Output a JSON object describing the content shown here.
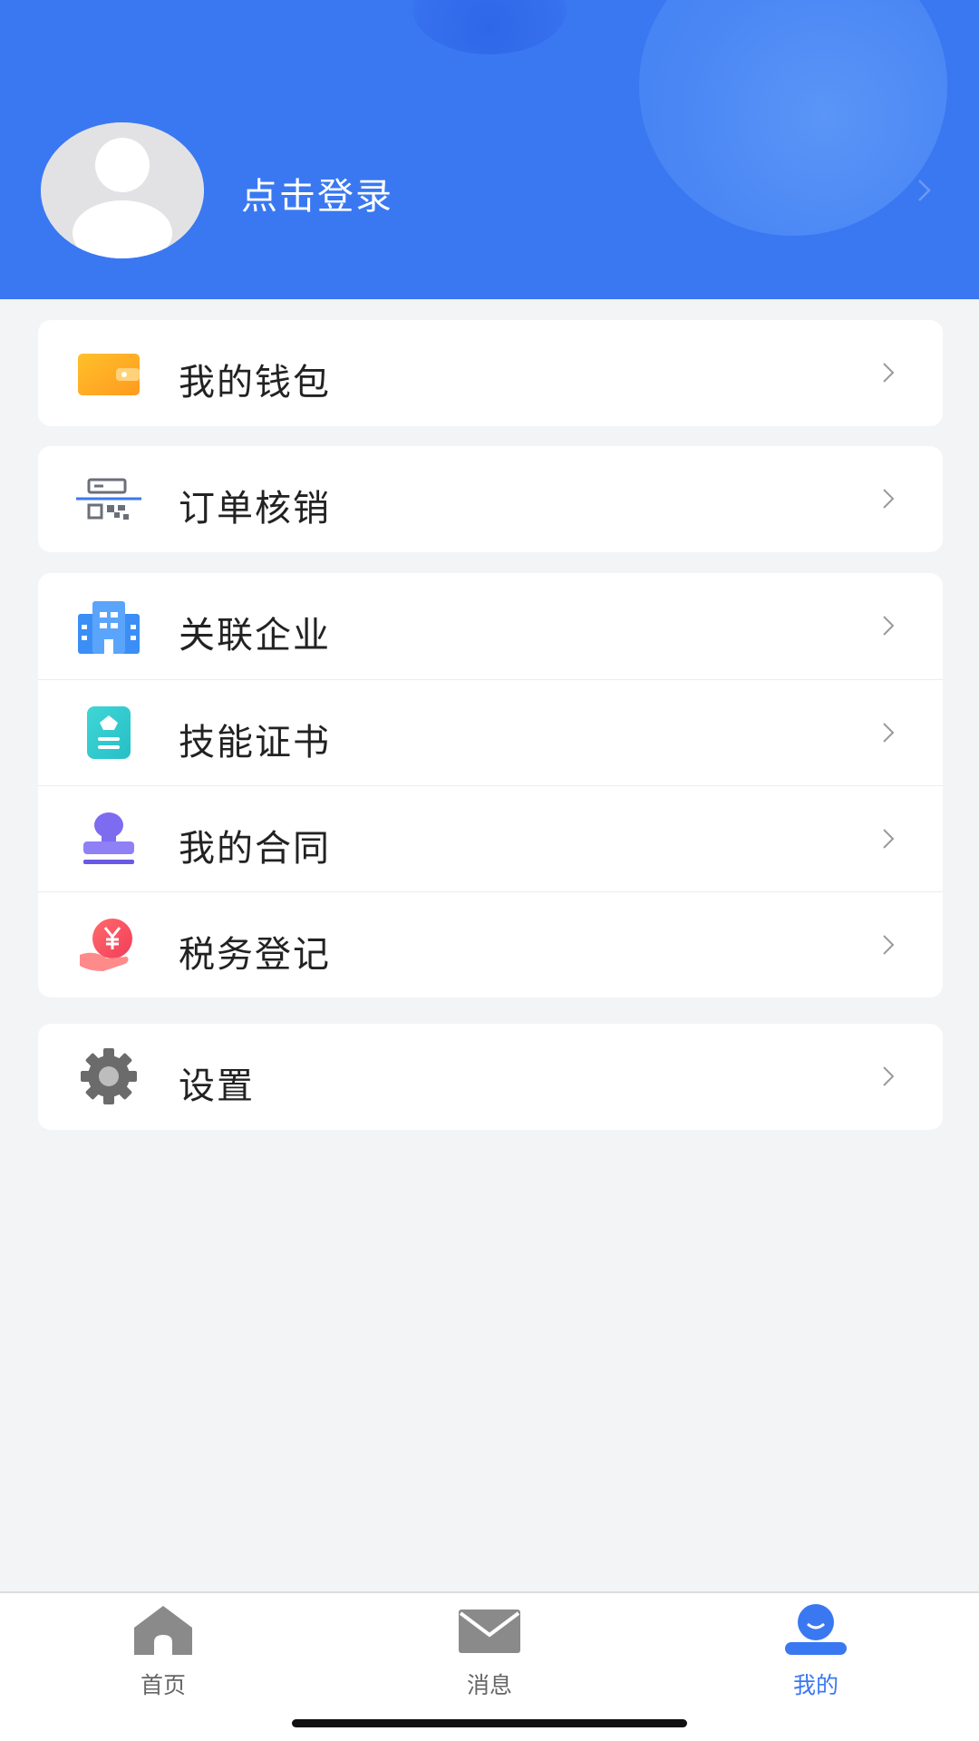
{
  "header": {
    "login_text": "点击登录",
    "background_color": "#3a78f2"
  },
  "menu": {
    "wallet": "我的钱包",
    "order_verify": "订单核销",
    "linked_company": "关联企业",
    "skill_certificate": "技能证书",
    "my_contract": "我的合同",
    "tax_registration": "税务登记",
    "settings": "设置"
  },
  "tabbar": {
    "home": "首页",
    "messages": "消息",
    "mine": "我的",
    "active_color": "#3a78f2",
    "active_tab": "mine"
  },
  "icons": {
    "wallet": "wallet-icon",
    "order_verify": "qr-scan-icon",
    "linked_company": "building-icon",
    "skill_certificate": "certificate-icon",
    "my_contract": "stamp-icon",
    "tax_registration": "yuan-hand-icon",
    "settings": "gear-icon"
  }
}
